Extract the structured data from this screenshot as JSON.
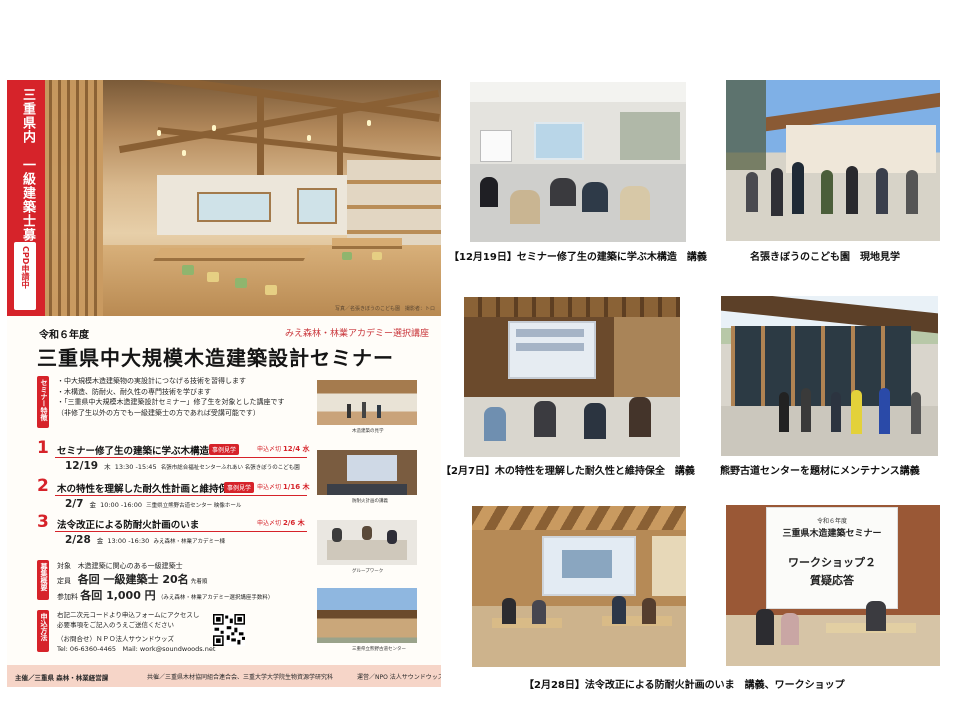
{
  "flyer": {
    "tagline": "三重県内　一級建築士募集",
    "cpd_badge": "CPD申請中",
    "photo_credit": "写真／名張きぼうのこども園　撮影者：トロ",
    "year": "令和６年度",
    "academy": "みえ森林・林業アカデミー選択講座",
    "title": "三重県中大規模木造建築設計セミナー",
    "features_tag": "セミナー特徴",
    "features": [
      "・中大規模木造建築物の実設計につなげる技術を習得します",
      "・木構造、防耐火、耐久性の専門技術を学びます",
      "・「三重県中大規模木造建築設計セミナー」修了生を対象とした講座です",
      "（非修了生以外の方でも一級建築士の方であれば受講可能です）"
    ],
    "sessions": [
      {
        "num": "1",
        "title": "セミナー修了生の建築に学ぶ木構造",
        "site_badge": "事例見学",
        "apply_label": "申込〆切",
        "apply_date": "12/4 水",
        "date": "12/19",
        "weekday": "木",
        "time": "13:30 -15:45",
        "venue": "名張市総合福祉センターふれあい 名張きぼうのこども園",
        "thumb_caption": "木造建築の見学"
      },
      {
        "num": "2",
        "title": "木の特性を理解した耐久性計画と維持保全",
        "site_badge": "事例見学",
        "apply_label": "申込〆切",
        "apply_date": "1/16 木",
        "date": "2/7",
        "weekday": "金",
        "time": "10:00 -16:00",
        "venue": "三重県立熊野古道センター 映像ホール",
        "thumb_caption": "防耐火計画の講義"
      },
      {
        "num": "3",
        "title": "法令改正による防耐火計画のいま",
        "site_badge": "",
        "apply_label": "申込〆切",
        "apply_date": "2/6 木",
        "date": "2/28",
        "weekday": "金",
        "time": "13:00 -16:30",
        "venue": "みえ森林・林業アカデミー棟",
        "thumb_caption": "グループワーク"
      }
    ],
    "thumb4_caption": "三重県立熊野古道センター",
    "details_tag": "募集概要",
    "target_label": "対象",
    "target": "木造建築に関心のある一級建築士",
    "capacity_label": "定員",
    "capacity": "各回 一級建築士 20名",
    "capacity_note": "先着順",
    "fee_label": "参加料",
    "fee": "各回 1,000 円",
    "fee_note": "（みえ森林・林業アカデミー選択講座手数料）",
    "apply_tag": "申込方法",
    "contact_lines": [
      "右記二次元コードより申込フォームにアクセスし",
      "必要事項をご記入のうえご送信ください",
      "（お問合せ）ＮＰＯ法人サウンドウッズ",
      "Tel: 06-6360-4465　Mail: work@soundwoods.net"
    ],
    "footer": {
      "organizer": "主催／三重県 森林・林業経営課",
      "cosponsor": "共催／三重県木材協同組合連合会、三重大学大学院生物資源学研究科",
      "operator": "運営／NPO 法人サウンドウッズ"
    }
  },
  "captions": {
    "p1": "【12月19日】セミナー修了生の建築に学ぶ木構造　講義",
    "p2": "名張きぼうのこども園　現地見学",
    "p3": "【2月7日】木の特性を理解した耐久性と維持保全　講義",
    "p4": "熊野古道センターを題材にメンテナンス講義",
    "p5": "【2月28日】法令改正による防耐火計画のいま　講義、ワークショップ"
  },
  "slides": {
    "p6_line1": "令和６年度",
    "p6_line2": "三重県木造建築セミナー",
    "p6_line3": "ワークショップ２",
    "p6_line4": "質疑応答"
  },
  "colors": {
    "accent_red": "#d6232a",
    "footer_pink": "#f6d5c8",
    "wood": "#c99a60"
  }
}
